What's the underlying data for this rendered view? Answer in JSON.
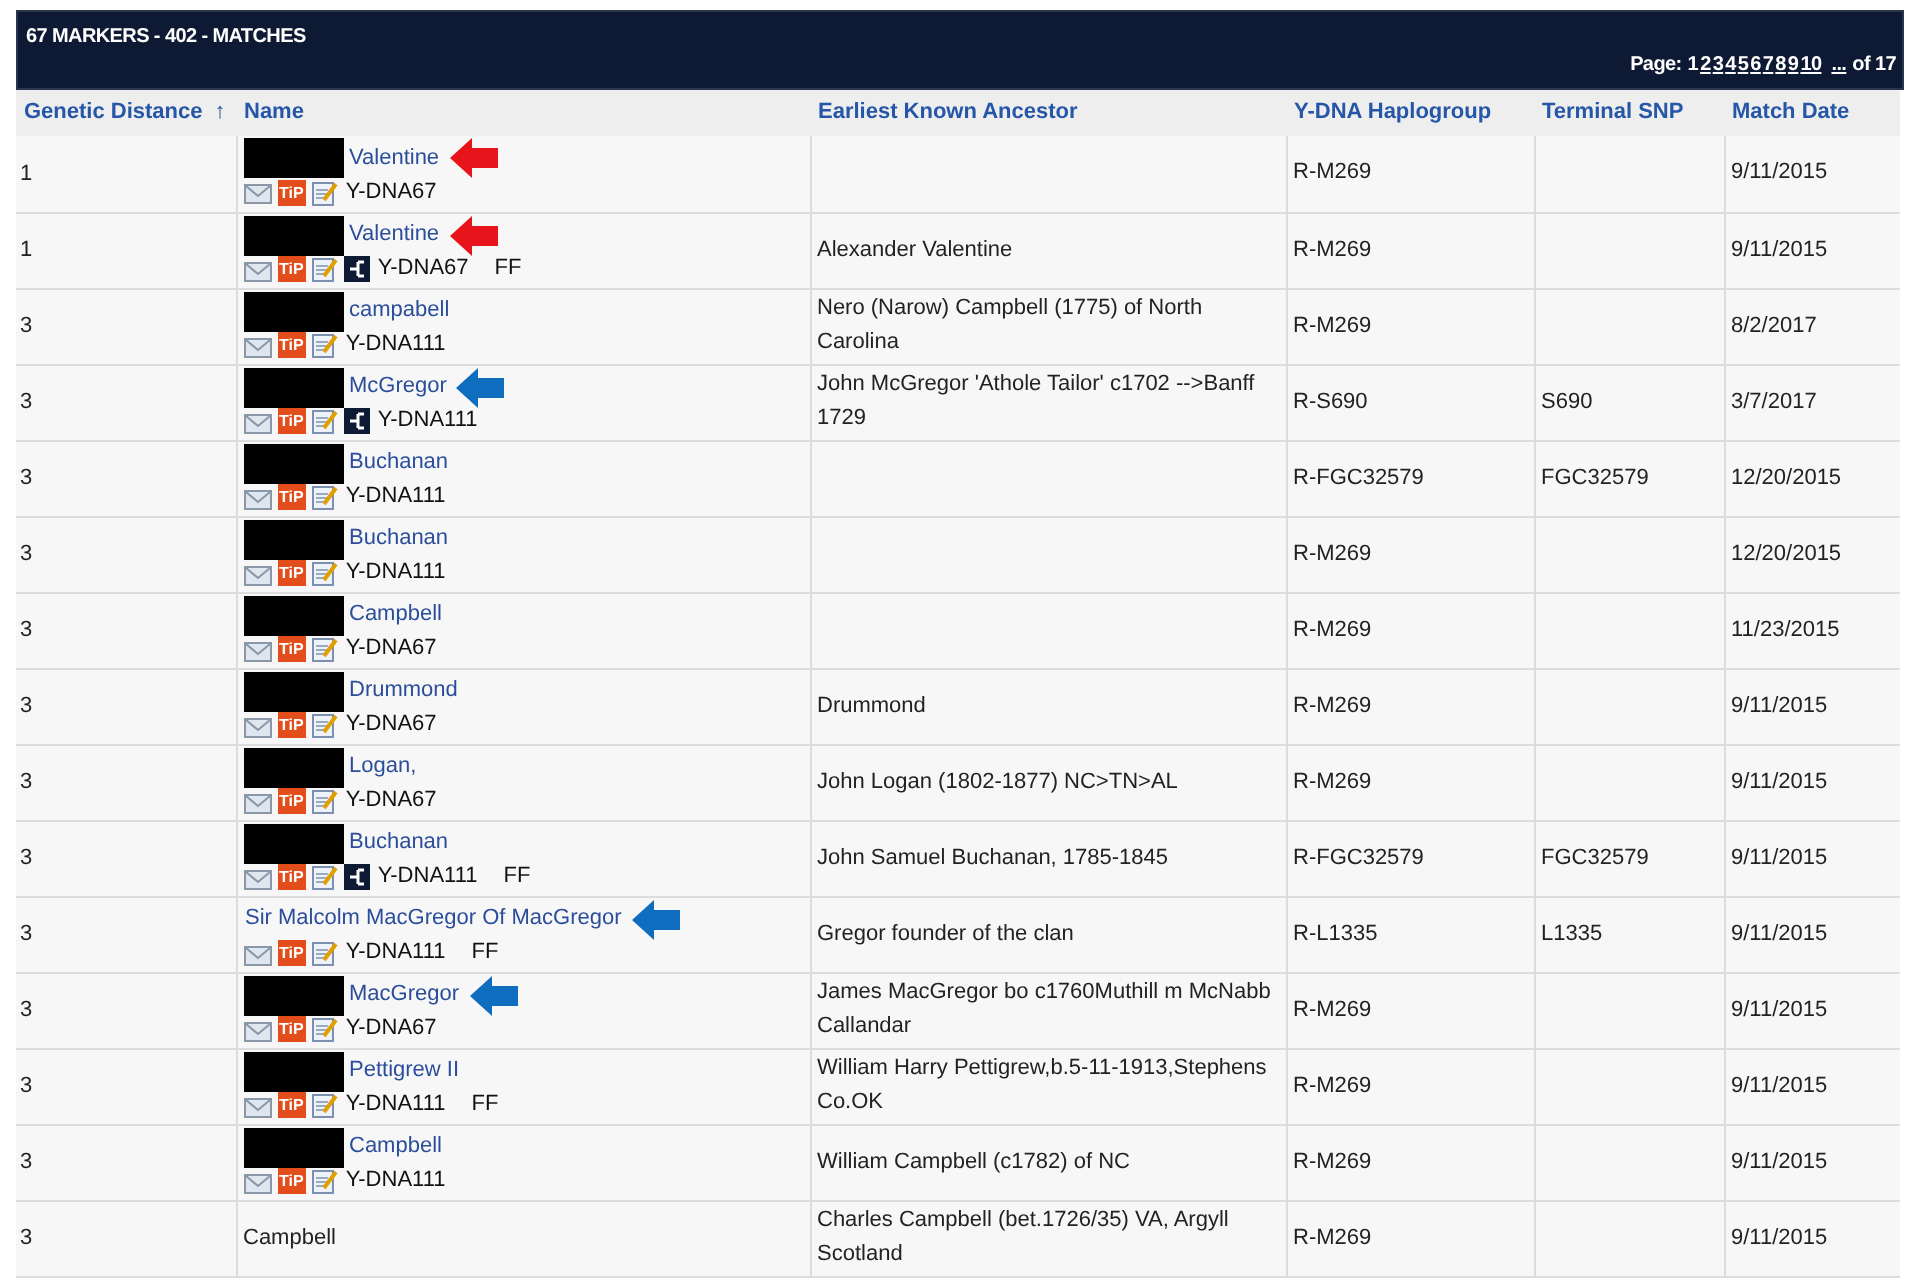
{
  "panel": {
    "title": "67 MARKERS - 402 - MATCHES",
    "pager": {
      "label": "Page:",
      "pages": [
        {
          "label": "1",
          "selected": true
        },
        {
          "label": "2",
          "selected": false
        },
        {
          "label": "3",
          "selected": false
        },
        {
          "label": "4",
          "selected": false
        },
        {
          "label": "5",
          "selected": false
        },
        {
          "label": "6",
          "selected": false
        },
        {
          "label": "7",
          "selected": false
        },
        {
          "label": "8",
          "selected": false
        },
        {
          "label": "9",
          "selected": false
        },
        {
          "label": "10",
          "selected": false
        },
        {
          "label": "...",
          "selected": false
        }
      ],
      "total": "of 17"
    }
  },
  "table": {
    "columns": [
      {
        "label": "Genetic Distance",
        "sort_indicator": "↑"
      },
      {
        "label": "Name"
      },
      {
        "label": "Earliest Known Ancestor"
      },
      {
        "label": "Y-DNA Haplogroup"
      },
      {
        "label": "Terminal SNP"
      },
      {
        "label": "Match Date"
      }
    ],
    "rows": [
      {
        "distance": "1",
        "name": {
          "kind": "link",
          "redacted": true,
          "text": "Valentine",
          "arrow": {
            "color": "#e8141b"
          }
        },
        "tip": "TiP",
        "tree": false,
        "test": "Y-DNA67",
        "haplogroup": "R-M269",
        "date": "9/11/2015"
      },
      {
        "distance": "1",
        "name": {
          "kind": "link",
          "redacted": true,
          "text": "Valentine",
          "arrow": {
            "color": "#e8141b"
          }
        },
        "tip": "TiP",
        "tree": true,
        "test": "Y-DNA67",
        "badge": "FF",
        "ancestor": "Alexander Valentine",
        "haplogroup": "R-M269",
        "date": "9/11/2015"
      },
      {
        "distance": "3",
        "name": {
          "kind": "link",
          "redacted": true,
          "text": "campabell"
        },
        "tip": "TiP",
        "tree": false,
        "test": "Y-DNA111",
        "ancestor": "Nero (Narow) Campbell (1775) of North Carolina",
        "haplogroup": "R-M269",
        "date": "8/2/2017"
      },
      {
        "distance": "3",
        "name": {
          "kind": "link",
          "redacted": true,
          "text": "McGregor",
          "arrow": {
            "color": "#0f6dbf"
          }
        },
        "tip": "TiP",
        "tree": true,
        "test": "Y-DNA111",
        "ancestor": "John McGregor 'Athole Tailor' c1702 -->Banff 1729",
        "haplogroup": "R-S690",
        "snp": "S690",
        "date": "3/7/2017"
      },
      {
        "distance": "3",
        "name": {
          "kind": "link",
          "redacted": true,
          "text": "Buchanan"
        },
        "tip": "TiP",
        "tree": false,
        "test": "Y-DNA111",
        "haplogroup": "R-FGC32579",
        "snp": "FGC32579",
        "date": "12/20/2015"
      },
      {
        "distance": "3",
        "name": {
          "kind": "link",
          "redacted": true,
          "text": "Buchanan"
        },
        "tip": "TiP",
        "tree": false,
        "test": "Y-DNA111",
        "haplogroup": "R-M269",
        "date": "12/20/2015"
      },
      {
        "distance": "3",
        "name": {
          "kind": "link",
          "redacted": true,
          "text": "Campbell"
        },
        "tip": "TiP",
        "tree": false,
        "test": "Y-DNA67",
        "haplogroup": "R-M269",
        "date": "11/23/2015"
      },
      {
        "distance": "3",
        "name": {
          "kind": "link",
          "redacted": true,
          "text": "Drummond"
        },
        "tip": "TiP",
        "tree": false,
        "test": "Y-DNA67",
        "ancestor": "Drummond",
        "haplogroup": "R-M269",
        "date": "9/11/2015"
      },
      {
        "distance": "3",
        "name": {
          "kind": "link",
          "redacted": true,
          "text": "Logan,"
        },
        "tip": "TiP",
        "tree": false,
        "test": "Y-DNA67",
        "ancestor": "John Logan (1802-1877) NC>TN>AL",
        "haplogroup": "R-M269",
        "date": "9/11/2015"
      },
      {
        "distance": "3",
        "name": {
          "kind": "link",
          "redacted": true,
          "text": "Buchanan"
        },
        "tip": "TiP",
        "tree": true,
        "test": "Y-DNA111",
        "badge": "FF",
        "ancestor": "John Samuel Buchanan, 1785-1845",
        "haplogroup": "R-FGC32579",
        "snp": "FGC32579",
        "date": "9/11/2015"
      },
      {
        "distance": "3",
        "name": {
          "kind": "link",
          "text": "Sir Malcolm MacGregor Of MacGregor",
          "arrow": {
            "color": "#0f6dbf"
          }
        },
        "tip": "TiP",
        "tree": false,
        "test": "Y-DNA111",
        "badge": "FF",
        "ancestor": "Gregor founder of the clan",
        "haplogroup": "R-L1335",
        "snp": "L1335",
        "date": "9/11/2015"
      },
      {
        "distance": "3",
        "name": {
          "kind": "link",
          "redacted": true,
          "text": "MacGregor",
          "arrow": {
            "color": "#0f6dbf"
          }
        },
        "tip": "TiP",
        "tree": false,
        "test": "Y-DNA67",
        "ancestor": "James MacGregor bo c1760Muthill m McNabb Callandar",
        "haplogroup": "R-M269",
        "date": "9/11/2015"
      },
      {
        "distance": "3",
        "name": {
          "kind": "link",
          "redacted": true,
          "text": "Pettigrew II"
        },
        "tip": "TiP",
        "tree": false,
        "test": "Y-DNA111",
        "badge": "FF",
        "ancestor": "William Harry Pettigrew,b.5-11-1913,Stephens Co.OK",
        "haplogroup": "R-M269",
        "date": "9/11/2015"
      },
      {
        "distance": "3",
        "name": {
          "kind": "link",
          "redacted": true,
          "text": "Campbell"
        },
        "tip": "TiP",
        "tree": false,
        "test": "Y-DNA111",
        "ancestor": "William Campbell (c1782) of NC",
        "haplogroup": "R-M269",
        "date": "9/11/2015"
      },
      {
        "distance": "3",
        "name": {
          "kind": "plain",
          "text": "Campbell"
        },
        "ancestor": "Charles Campbell (bet.1726/35) VA, Argyll Scotland",
        "haplogroup": "R-M269",
        "date": "9/11/2015"
      }
    ]
  }
}
